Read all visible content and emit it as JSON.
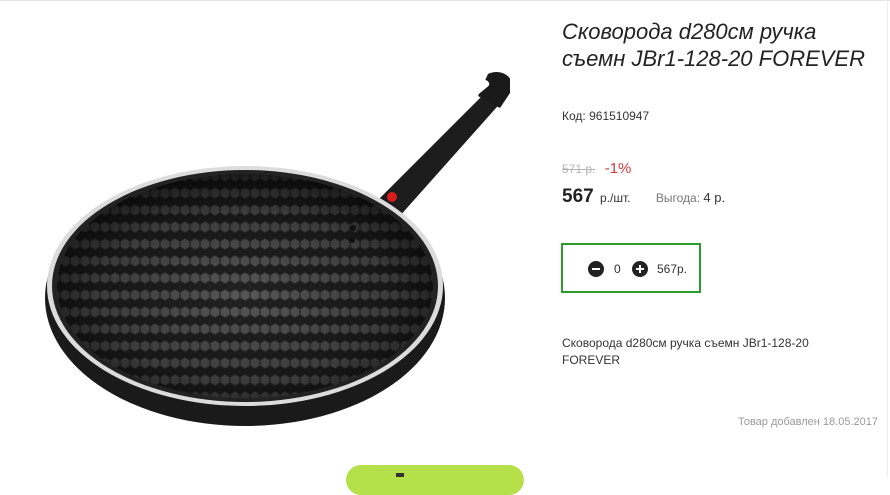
{
  "product": {
    "title": "Сковорода d280см ручка съемн JBr1-128-20 FOREVER",
    "code_label": "Код:",
    "code_value": "961510947",
    "image_icon": "frying-pan-image"
  },
  "pricing": {
    "old_price": "571 р.",
    "discount": "-1%",
    "price": "567",
    "price_unit": "р./шт.",
    "benefit_label": "Выгода:",
    "benefit_value": "4 р."
  },
  "cart": {
    "quantity": "0",
    "total": "567р.",
    "minus_icon": "minus-circle-icon",
    "plus_icon": "plus-circle-icon",
    "border_color": "#2c9a2f"
  },
  "description": "Сковорода d280см ручка съемн JBr1-128-20 FOREVER",
  "added_date": "Товар добавлен 18.05.2017",
  "colors": {
    "discount": "#d23a3a",
    "button": "#b6e04a"
  }
}
